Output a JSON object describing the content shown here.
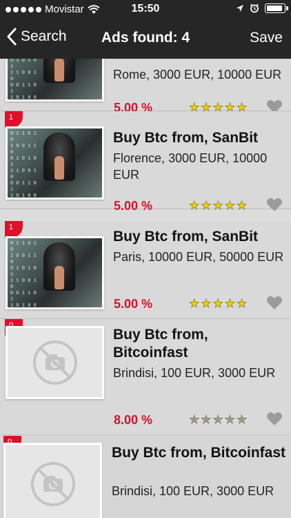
{
  "status_bar": {
    "carrier": "Movistar",
    "time": "15:50"
  },
  "nav": {
    "back_label": "Search",
    "title": "Ads found: 4",
    "save_label": "Save"
  },
  "ads": [
    {
      "title": "",
      "details": "Rome, 3000 EUR, 10000 EUR",
      "rate": "5.00 %",
      "rating": 5,
      "badge": "",
      "image": "photo"
    },
    {
      "title": "Buy Btc from, SanBit",
      "details": "Florence, 3000 EUR, 10000 EUR",
      "rate": "5.00 %",
      "rating": 5,
      "badge": "1",
      "image": "photo"
    },
    {
      "title": "Buy Btc from, SanBit",
      "details": "Paris, 10000 EUR, 50000 EUR",
      "rate": "5.00 %",
      "rating": 5,
      "badge": "1",
      "image": "photo"
    },
    {
      "title": "Buy Btc from, Bitcoinfast",
      "details": "Brindisi, 100 EUR, 3000 EUR",
      "rate": "8.00 %",
      "rating": 0,
      "badge": "0",
      "image": "placeholder"
    },
    {
      "title": "Buy Btc from, Bitcoinfast",
      "details": "Brindisi, 100 EUR, 3000 EUR",
      "rate": "",
      "rating": 0,
      "badge": "0",
      "image": "placeholder"
    }
  ],
  "icons": {
    "back": "chevron-left-icon",
    "wifi": "wifi-icon",
    "location": "location-arrow-icon",
    "alarm": "alarm-clock-icon",
    "battery": "battery-icon",
    "favorite": "heart-icon",
    "star": "star-icon",
    "no-photo": "no-camera-icon"
  },
  "colors": {
    "bar": "#262626",
    "accent": "#e0102a",
    "rate": "#d0152b",
    "star_active": "#f2d200",
    "star_inactive": "#a5a08a"
  }
}
